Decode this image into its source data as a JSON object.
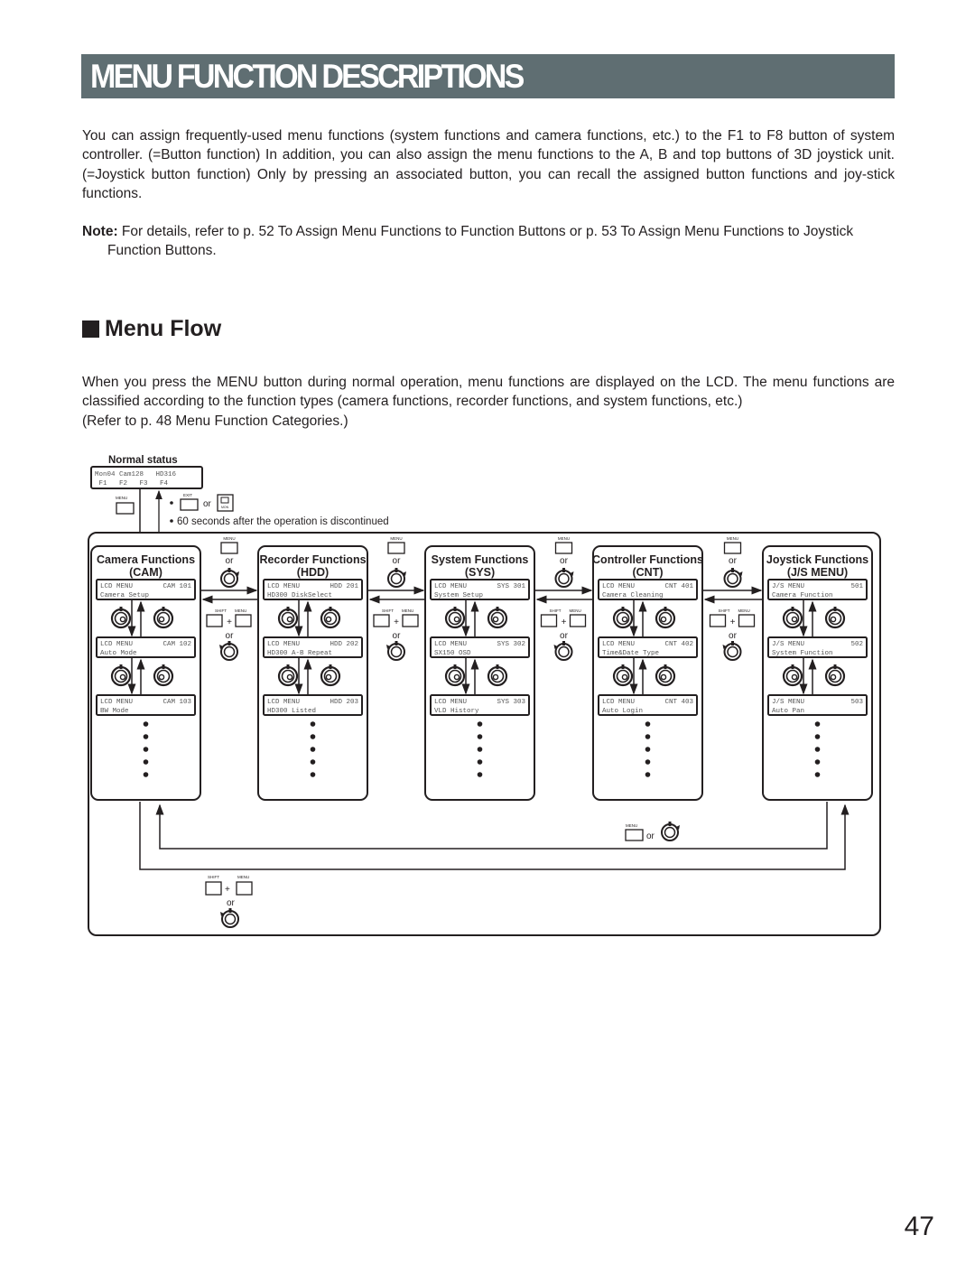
{
  "page": {
    "title": "MENU FUNCTION DESCRIPTIONS",
    "intro": "You can assign frequently-used menu functions (system functions and camera functions, etc.) to the F1 to F8 button of system controller. (=Button function) In addition, you can also assign the menu functions to the A, B and top buttons of 3D joystick unit. (=Joystick button function) Only by pressing an associated button, you can recall the assigned button functions and joy-stick functions.",
    "note_label": "Note:",
    "note_text": " For details, refer to p. 52 To Assign Menu Functions to Function Buttons or p. 53 To Assign Menu Functions to Joystick",
    "note_text_cont": "Function Buttons.",
    "section_title": "Menu Flow",
    "flow_line1": "When you press the MENU button during normal operation, menu functions are displayed on the LCD. The menu functions are",
    "flow_line2": "classified according to the function types (camera functions, recorder functions, and system functions, etc.)",
    "flow_line3": "(Refer to p. 48 Menu Function Categories.)",
    "page_number": "47"
  },
  "diagram": {
    "normal_status": {
      "label": "Normal status",
      "lcd_line1": "Mon04 Cam128   HD316",
      "lcd_line2": " F1   F2   F3   F4",
      "menu_key": "MENU",
      "exit_key": "EXIT",
      "or": "or",
      "bullet_text": "60 seconds after the operation is discontinued",
      "monitor_icon_label": "MON"
    },
    "keys": {
      "menu": "MENU",
      "shift": "SHIFT",
      "or": "or",
      "plus": "+"
    },
    "groups": [
      {
        "title": "Camera Functions",
        "code": "(CAM)",
        "screens": [
          {
            "l1": "LCD MENU",
            "r1": "CAM 101",
            "l2": "Camera Setup"
          },
          {
            "l1": "LCD MENU",
            "r1": "CAM 102",
            "l2": "Auto Mode"
          },
          {
            "l1": "LCD MENU",
            "r1": "CAM 103",
            "l2": "BW Mode"
          }
        ]
      },
      {
        "title": "Recorder Functions",
        "code": "(HDD)",
        "screens": [
          {
            "l1": "LCD MENU",
            "r1": "HDD 201",
            "l2": "HD300 DiskSelect"
          },
          {
            "l1": "LCD MENU",
            "r1": "HDD 202",
            "l2": "HD300 A-B Repeat"
          },
          {
            "l1": "LCD MENU",
            "r1": "HDD 203",
            "l2": "HD300 Listed"
          }
        ]
      },
      {
        "title": "System Functions",
        "code": "(SYS)",
        "screens": [
          {
            "l1": "LCD MENU",
            "r1": "SYS 301",
            "l2": "System Setup"
          },
          {
            "l1": "LCD MENU",
            "r1": "SYS 302",
            "l2": "SX150 OSD"
          },
          {
            "l1": "LCD MENU",
            "r1": "SYS 303",
            "l2": "VLD History"
          }
        ]
      },
      {
        "title": "Controller Functions",
        "code": "(CNT)",
        "screens": [
          {
            "l1": "LCD MENU",
            "r1": "CNT 401",
            "l2": "Camera Cleaning"
          },
          {
            "l1": "LCD MENU",
            "r1": "CNT 402",
            "l2": "Time&Date Type"
          },
          {
            "l1": "LCD MENU",
            "r1": "CNT 403",
            "l2": "Auto Login"
          }
        ]
      },
      {
        "title": "Joystick Functions",
        "code": "(J/S MENU)",
        "screens": [
          {
            "l1": "J/S MENU",
            "r1": "501",
            "l2": "Camera Function"
          },
          {
            "l1": "J/S MENU",
            "r1": "502",
            "l2": "System Function"
          },
          {
            "l1": "J/S MENU",
            "r1": "503",
            "l2": "Auto Pan"
          }
        ]
      }
    ]
  }
}
